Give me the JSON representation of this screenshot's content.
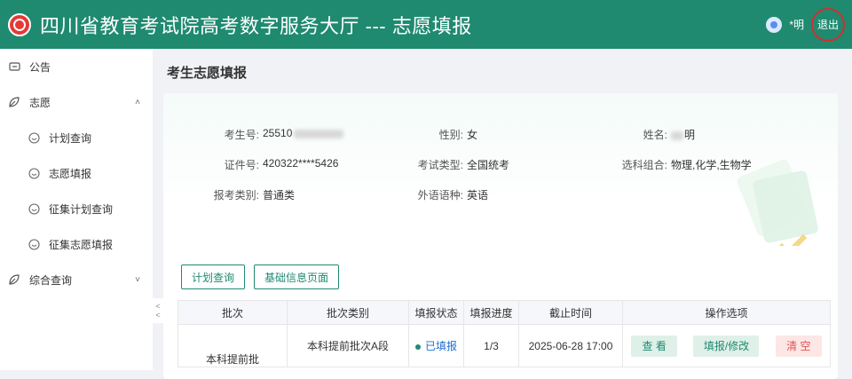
{
  "header": {
    "title": "四川省教育考试院高考数字服务大厅 --- 志愿填报",
    "username": "*明",
    "logout": "退出"
  },
  "sidebar": {
    "items": [
      {
        "label": "公告"
      },
      {
        "label": "志愿"
      },
      {
        "label": "计划查询"
      },
      {
        "label": "志愿填报"
      },
      {
        "label": "征集计划查询"
      },
      {
        "label": "征集志愿填报"
      },
      {
        "label": "综合查询"
      }
    ],
    "toggle_glyphs": "‹ ‹"
  },
  "page": {
    "title": "考生志愿填报"
  },
  "info": {
    "exam_no_label": "考生号:",
    "exam_no_value": "25510",
    "gender_label": "性别:",
    "gender_value": "女",
    "name_label": "姓名:",
    "name_value": "明",
    "id_label": "证件号:",
    "id_value": "420322****5426",
    "exam_type_label": "考试类型:",
    "exam_type_value": "全国统考",
    "subjects_label": "选科组合:",
    "subjects_value": "物理,化学,生物学",
    "category_label": "报考类别:",
    "category_value": "普通类",
    "language_label": "外语语种:",
    "language_value": "英语"
  },
  "actions": {
    "plan_query": "计划查询",
    "basic_info": "基础信息页面"
  },
  "table": {
    "headers": [
      "批次",
      "批次类别",
      "填报状态",
      "填报进度",
      "截止时间",
      "操作选项"
    ],
    "rows": [
      {
        "batch": "本科提前批",
        "category": "本科提前批次A段",
        "status": "已填报",
        "progress": "1/3",
        "deadline": "2025-06-28 17:00",
        "ops": [
          "查 看",
          "填报/修改",
          "清 空"
        ]
      }
    ]
  },
  "colors": {
    "brand": "#1f8a70",
    "logout_ring": "#d32f2f",
    "status_link": "#1f6fd1",
    "danger": "#e05555"
  }
}
